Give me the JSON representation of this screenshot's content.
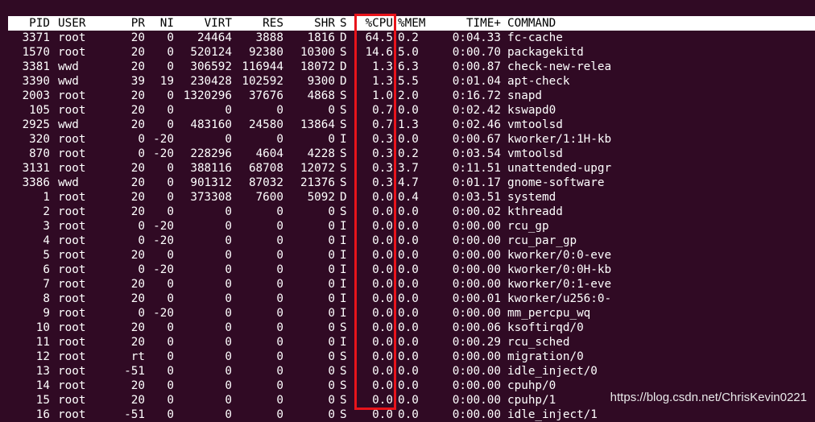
{
  "columns": {
    "pid": "PID",
    "user": "USER",
    "pr": "PR",
    "ni": "NI",
    "virt": "VIRT",
    "res": "RES",
    "shr": "SHR",
    "s": "S",
    "cpu": "%CPU",
    "mem": "%MEM",
    "time": "TIME+",
    "command": "COMMAND"
  },
  "processes": [
    {
      "pid": "3371",
      "user": "root",
      "pr": "20",
      "ni": "0",
      "virt": "24464",
      "res": "3888",
      "shr": "1816",
      "s": "D",
      "cpu": "64.5",
      "mem": "0.2",
      "time": "0:04.33",
      "command": "fc-cache"
    },
    {
      "pid": "1570",
      "user": "root",
      "pr": "20",
      "ni": "0",
      "virt": "520124",
      "res": "92380",
      "shr": "10300",
      "s": "S",
      "cpu": "14.6",
      "mem": "5.0",
      "time": "0:00.70",
      "command": "packagekitd"
    },
    {
      "pid": "3381",
      "user": "wwd",
      "pr": "20",
      "ni": "0",
      "virt": "306592",
      "res": "116944",
      "shr": "18072",
      "s": "D",
      "cpu": "1.3",
      "mem": "6.3",
      "time": "0:00.87",
      "command": "check-new-relea"
    },
    {
      "pid": "3390",
      "user": "wwd",
      "pr": "39",
      "ni": "19",
      "virt": "230428",
      "res": "102592",
      "shr": "9300",
      "s": "D",
      "cpu": "1.3",
      "mem": "5.5",
      "time": "0:01.04",
      "command": "apt-check"
    },
    {
      "pid": "2003",
      "user": "root",
      "pr": "20",
      "ni": "0",
      "virt": "1320296",
      "res": "37676",
      "shr": "4868",
      "s": "S",
      "cpu": "1.0",
      "mem": "2.0",
      "time": "0:16.72",
      "command": "snapd"
    },
    {
      "pid": "105",
      "user": "root",
      "pr": "20",
      "ni": "0",
      "virt": "0",
      "res": "0",
      "shr": "0",
      "s": "S",
      "cpu": "0.7",
      "mem": "0.0",
      "time": "0:02.42",
      "command": "kswapd0"
    },
    {
      "pid": "2925",
      "user": "wwd",
      "pr": "20",
      "ni": "0",
      "virt": "483160",
      "res": "24580",
      "shr": "13864",
      "s": "S",
      "cpu": "0.7",
      "mem": "1.3",
      "time": "0:02.46",
      "command": "vmtoolsd"
    },
    {
      "pid": "320",
      "user": "root",
      "pr": "0",
      "ni": "-20",
      "virt": "0",
      "res": "0",
      "shr": "0",
      "s": "I",
      "cpu": "0.3",
      "mem": "0.0",
      "time": "0:00.67",
      "command": "kworker/1:1H-kb"
    },
    {
      "pid": "870",
      "user": "root",
      "pr": "0",
      "ni": "-20",
      "virt": "228296",
      "res": "4604",
      "shr": "4228",
      "s": "S",
      "cpu": "0.3",
      "mem": "0.2",
      "time": "0:03.54",
      "command": "vmtoolsd"
    },
    {
      "pid": "3131",
      "user": "root",
      "pr": "20",
      "ni": "0",
      "virt": "388116",
      "res": "68708",
      "shr": "12072",
      "s": "S",
      "cpu": "0.3",
      "mem": "3.7",
      "time": "0:11.51",
      "command": "unattended-upgr"
    },
    {
      "pid": "3386",
      "user": "wwd",
      "pr": "20",
      "ni": "0",
      "virt": "901312",
      "res": "87032",
      "shr": "21376",
      "s": "S",
      "cpu": "0.3",
      "mem": "4.7",
      "time": "0:01.17",
      "command": "gnome-software"
    },
    {
      "pid": "1",
      "user": "root",
      "pr": "20",
      "ni": "0",
      "virt": "373308",
      "res": "7600",
      "shr": "5092",
      "s": "D",
      "cpu": "0.0",
      "mem": "0.4",
      "time": "0:03.51",
      "command": "systemd"
    },
    {
      "pid": "2",
      "user": "root",
      "pr": "20",
      "ni": "0",
      "virt": "0",
      "res": "0",
      "shr": "0",
      "s": "S",
      "cpu": "0.0",
      "mem": "0.0",
      "time": "0:00.02",
      "command": "kthreadd"
    },
    {
      "pid": "3",
      "user": "root",
      "pr": "0",
      "ni": "-20",
      "virt": "0",
      "res": "0",
      "shr": "0",
      "s": "I",
      "cpu": "0.0",
      "mem": "0.0",
      "time": "0:00.00",
      "command": "rcu_gp"
    },
    {
      "pid": "4",
      "user": "root",
      "pr": "0",
      "ni": "-20",
      "virt": "0",
      "res": "0",
      "shr": "0",
      "s": "I",
      "cpu": "0.0",
      "mem": "0.0",
      "time": "0:00.00",
      "command": "rcu_par_gp"
    },
    {
      "pid": "5",
      "user": "root",
      "pr": "20",
      "ni": "0",
      "virt": "0",
      "res": "0",
      "shr": "0",
      "s": "I",
      "cpu": "0.0",
      "mem": "0.0",
      "time": "0:00.00",
      "command": "kworker/0:0-eve"
    },
    {
      "pid": "6",
      "user": "root",
      "pr": "0",
      "ni": "-20",
      "virt": "0",
      "res": "0",
      "shr": "0",
      "s": "I",
      "cpu": "0.0",
      "mem": "0.0",
      "time": "0:00.00",
      "command": "kworker/0:0H-kb"
    },
    {
      "pid": "7",
      "user": "root",
      "pr": "20",
      "ni": "0",
      "virt": "0",
      "res": "0",
      "shr": "0",
      "s": "I",
      "cpu": "0.0",
      "mem": "0.0",
      "time": "0:00.00",
      "command": "kworker/0:1-eve"
    },
    {
      "pid": "8",
      "user": "root",
      "pr": "20",
      "ni": "0",
      "virt": "0",
      "res": "0",
      "shr": "0",
      "s": "I",
      "cpu": "0.0",
      "mem": "0.0",
      "time": "0:00.01",
      "command": "kworker/u256:0-"
    },
    {
      "pid": "9",
      "user": "root",
      "pr": "0",
      "ni": "-20",
      "virt": "0",
      "res": "0",
      "shr": "0",
      "s": "I",
      "cpu": "0.0",
      "mem": "0.0",
      "time": "0:00.00",
      "command": "mm_percpu_wq"
    },
    {
      "pid": "10",
      "user": "root",
      "pr": "20",
      "ni": "0",
      "virt": "0",
      "res": "0",
      "shr": "0",
      "s": "S",
      "cpu": "0.0",
      "mem": "0.0",
      "time": "0:00.06",
      "command": "ksoftirqd/0"
    },
    {
      "pid": "11",
      "user": "root",
      "pr": "20",
      "ni": "0",
      "virt": "0",
      "res": "0",
      "shr": "0",
      "s": "I",
      "cpu": "0.0",
      "mem": "0.0",
      "time": "0:00.29",
      "command": "rcu_sched"
    },
    {
      "pid": "12",
      "user": "root",
      "pr": "rt",
      "ni": "0",
      "virt": "0",
      "res": "0",
      "shr": "0",
      "s": "S",
      "cpu": "0.0",
      "mem": "0.0",
      "time": "0:00.00",
      "command": "migration/0"
    },
    {
      "pid": "13",
      "user": "root",
      "pr": "-51",
      "ni": "0",
      "virt": "0",
      "res": "0",
      "shr": "0",
      "s": "S",
      "cpu": "0.0",
      "mem": "0.0",
      "time": "0:00.00",
      "command": "idle_inject/0"
    },
    {
      "pid": "14",
      "user": "root",
      "pr": "20",
      "ni": "0",
      "virt": "0",
      "res": "0",
      "shr": "0",
      "s": "S",
      "cpu": "0.0",
      "mem": "0.0",
      "time": "0:00.00",
      "command": "cpuhp/0"
    },
    {
      "pid": "15",
      "user": "root",
      "pr": "20",
      "ni": "0",
      "virt": "0",
      "res": "0",
      "shr": "0",
      "s": "S",
      "cpu": "0.0",
      "mem": "0.0",
      "time": "0:00.00",
      "command": "cpuhp/1"
    },
    {
      "pid": "16",
      "user": "root",
      "pr": "-51",
      "ni": "0",
      "virt": "0",
      "res": "0",
      "shr": "0",
      "s": "S",
      "cpu": "0.0",
      "mem": "0.0",
      "time": "0:00.00",
      "command": "idle_inject/1"
    }
  ],
  "watermark": "https://blog.csdn.net/ChrisKevin0221",
  "colors": {
    "background": "#300a24",
    "text": "#ffffff",
    "header_background": "#ffffff",
    "header_text": "#000000",
    "highlight": "#e8141b"
  }
}
